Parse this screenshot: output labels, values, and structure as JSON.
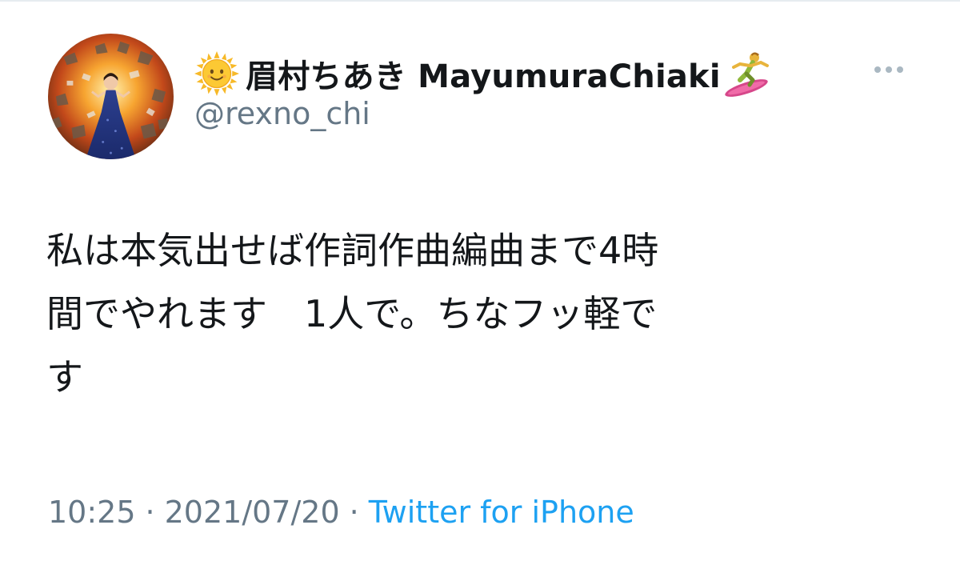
{
  "tweet": {
    "author": {
      "display_name": "眉村ちあき MayumuraChiaki",
      "handle": "@rexno_chi",
      "name_prefix_icon": "sun-with-face-emoji",
      "name_suffix_icon": "surfer-emoji"
    },
    "text_lines": [
      "私は本気出せば作詞作曲編曲まで4時",
      "間でやれます　1人で。ちなフッ軽で",
      "す"
    ],
    "time": "10:25",
    "separator": "·",
    "date": "2021/07/20",
    "source": "Twitter for iPhone",
    "more_icon": "more-horizontal-icon"
  },
  "colors": {
    "text_primary": "#14171a",
    "text_secondary": "#657786",
    "link": "#1da1f2",
    "divider": "#e6ecf0"
  }
}
